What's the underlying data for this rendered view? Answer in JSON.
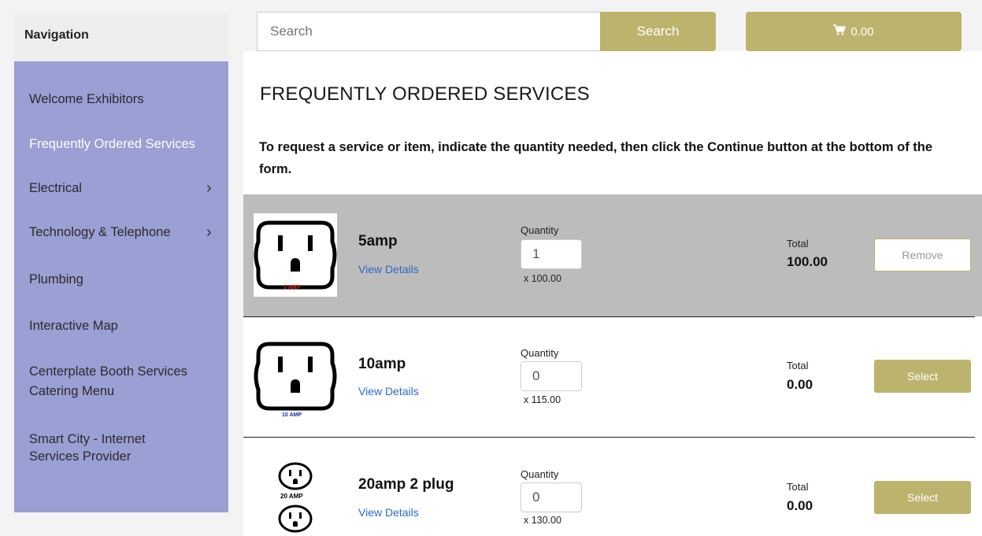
{
  "sidebar": {
    "heading": "Navigation",
    "items": [
      {
        "label": "Welcome Exhibitors"
      },
      {
        "label": "Frequently Ordered Services"
      },
      {
        "label": "Electrical",
        "chevron": "›"
      },
      {
        "label": "Technology & Telephone",
        "chevron": "›"
      },
      {
        "label": "Plumbing"
      },
      {
        "label": "Interactive Map"
      },
      {
        "label": "Centerplate Booth Services Catering Menu"
      },
      {
        "label": "Smart City - Internet Services Provider"
      }
    ]
  },
  "search": {
    "placeholder": "Search",
    "button_label": "Search"
  },
  "cart": {
    "icon": "cart-icon",
    "total": "0.00"
  },
  "page_title": "FREQUENTLY ORDERED SERVICES",
  "instructions": "To request a service or item, indicate the quantity needed, then click the Continue button at the bottom of the form.",
  "products": [
    {
      "name": "5amp",
      "details_link": "View Details",
      "quantity_label": "Quantity",
      "quantity": "1",
      "unit_price": "x 100.00",
      "total_label": "Total",
      "total": "100.00",
      "action": "Remove",
      "image_caption": "5 AMP"
    },
    {
      "name": "10amp",
      "details_link": "View Details",
      "quantity_label": "Quantity",
      "quantity": "0",
      "unit_price": "x 115.00",
      "total_label": "Total",
      "total": "0.00",
      "action": "Select",
      "image_caption": "10 AMP"
    },
    {
      "name": "20amp 2 plug",
      "details_link": "View Details",
      "quantity_label": "Quantity",
      "quantity": "0",
      "unit_price": "x 130.00",
      "total_label": "Total",
      "total": "0.00",
      "action": "Select",
      "image_caption": "20 AMP"
    }
  ],
  "colors": {
    "accent": "#bcb36d",
    "sidebar": "#9a9fd4",
    "selected_row": "#bcbcbc",
    "link": "#2a6ac4"
  }
}
